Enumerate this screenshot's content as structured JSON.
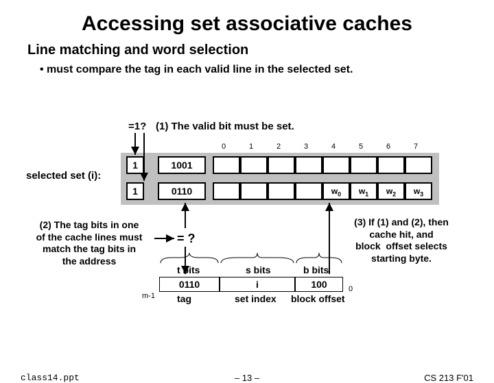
{
  "title": "Accessing set associative caches",
  "subtitle": "Line matching and word selection",
  "bullet": "must compare the tag in each valid line in the selected set.",
  "labels": {
    "valid_check": "=1?",
    "step1": "(1) The valid bit must be set.",
    "selected_set": "selected set (i):",
    "step2": "(2) The tag bits in one\nof the cache lines must\nmatch the tag bits in\nthe address",
    "compare": "= ?",
    "step3": "(3) If (1) and (2), then\ncache hit, and\nblock  offset selects\nstarting byte.",
    "t_bits": "t bits",
    "s_bits": "s bits",
    "b_bits": "b bits",
    "tag": "tag",
    "set_index": "set index",
    "block_offset": "block offset",
    "m_minus_1": "m-1",
    "zero": "0"
  },
  "lines": [
    {
      "valid": "1",
      "tag": "1001",
      "words": [
        "",
        "",
        "",
        "",
        "",
        "",
        "",
        ""
      ]
    },
    {
      "valid": "1",
      "tag": "0110",
      "words": [
        "",
        "",
        "",
        "",
        "w0",
        "w1",
        "w2",
        "w3"
      ]
    }
  ],
  "byte_indices": [
    "0",
    "1",
    "2",
    "3",
    "4",
    "5",
    "6",
    "7"
  ],
  "address": {
    "tag": "0110",
    "set": "i",
    "block": "100"
  },
  "footer": {
    "left": "class14.ppt",
    "mid": "– 13 –",
    "right": "CS 213 F'01"
  }
}
